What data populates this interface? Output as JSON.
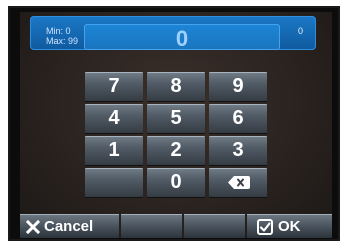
{
  "header": {
    "min_label": "Min: 0",
    "max_label": "Max: 99",
    "value": "0",
    "counter": "0"
  },
  "keypad": {
    "row1": [
      "7",
      "8",
      "9"
    ],
    "row2": [
      "4",
      "5",
      "6"
    ],
    "row3": [
      "1",
      "2",
      "3"
    ],
    "row4": [
      "",
      "0",
      "backspace-icon"
    ]
  },
  "footer": {
    "cancel_label": "Cancel",
    "ok_label": "OK",
    "cancel_icon": "x-icon",
    "ok_icon": "checkbox-icon"
  }
}
